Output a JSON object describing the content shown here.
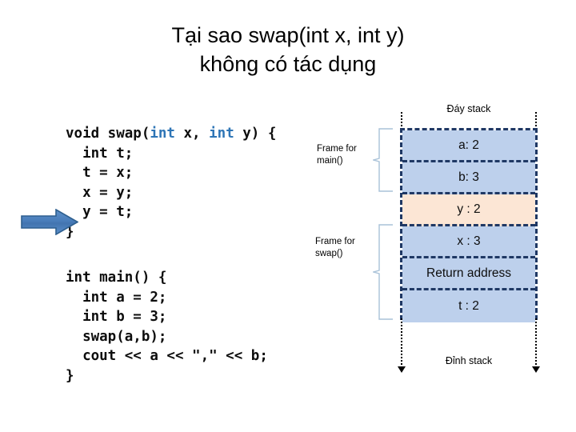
{
  "slide": {
    "title": "Tại sao swap(int x, int y)\nkhông có tác dụng"
  },
  "code": {
    "swap_function": {
      "name": "swap-function-code",
      "lines": [
        {
          "segments": [
            {
              "text": "void swap(",
              "kind": "plain"
            },
            {
              "text": "int",
              "kind": "keyword"
            },
            {
              "text": " x, ",
              "kind": "plain"
            },
            {
              "text": "int",
              "kind": "keyword"
            },
            {
              "text": " y) {",
              "kind": "plain"
            }
          ]
        },
        {
          "segments": [
            {
              "text": "  int t;",
              "kind": "plain"
            }
          ]
        },
        {
          "segments": [
            {
              "text": "  t = x;",
              "kind": "plain"
            }
          ]
        },
        {
          "segments": [
            {
              "text": "  x = y;",
              "kind": "plain"
            }
          ]
        },
        {
          "segments": [
            {
              "text": "  y = t;",
              "kind": "plain"
            }
          ]
        },
        {
          "segments": [
            {
              "text": "}",
              "kind": "plain"
            }
          ]
        }
      ]
    },
    "main_function": {
      "name": "main-function-code",
      "lines": [
        {
          "segments": [
            {
              "text": "int main() {",
              "kind": "plain"
            }
          ]
        },
        {
          "segments": [
            {
              "text": "  int a = 2;",
              "kind": "plain"
            }
          ]
        },
        {
          "segments": [
            {
              "text": "  int b = 3;",
              "kind": "plain"
            }
          ]
        },
        {
          "segments": [
            {
              "text": "  swap(a,b);",
              "kind": "plain"
            }
          ]
        },
        {
          "segments": [
            {
              "text": "  cout << a << \",\" << b;",
              "kind": "plain"
            }
          ]
        },
        {
          "segments": [
            {
              "text": "}",
              "kind": "plain"
            }
          ]
        }
      ]
    }
  },
  "annotations": {
    "step_arrow": {
      "icon": "right-arrow-icon",
      "points_to_line": "  y = t;"
    },
    "frame_main_label": "Frame for\nmain()",
    "frame_swap_label": "Frame for\nswap()"
  },
  "stack": {
    "caption_bottom": "Đáy stack",
    "caption_top": "Đỉnh stack",
    "cells": [
      {
        "label": "a: 2",
        "highlight": false
      },
      {
        "label": "b: 3",
        "highlight": false
      },
      {
        "label": "y : 2",
        "highlight": true
      },
      {
        "label": "x : 3",
        "highlight": false
      },
      {
        "label": "Return address",
        "highlight": false
      },
      {
        "label": "t : 2",
        "highlight": false
      }
    ]
  },
  "colors": {
    "keyword_blue": "#2e75b6",
    "cell_blue": "#bdd0ec",
    "cell_highlight": "#fce6d5",
    "border_navy": "#1f3864",
    "arrow_blue": "#4a7ebb",
    "arrow_outline": "#2e5f8f",
    "brace_gray_blue": "#a9c2d8",
    "background": "#ffffff"
  }
}
